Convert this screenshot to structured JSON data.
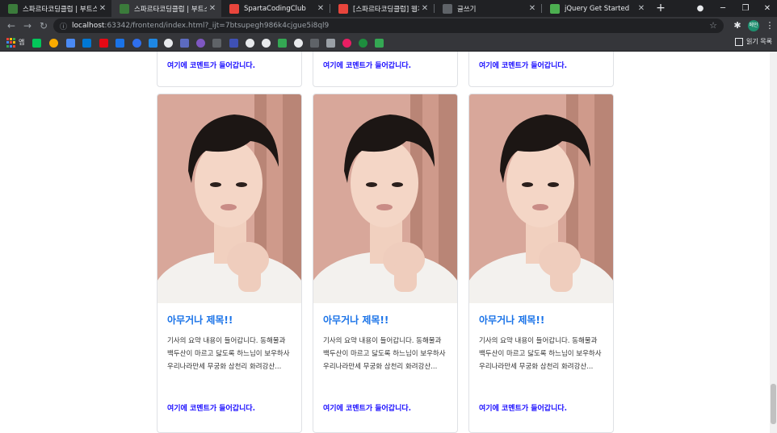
{
  "browser": {
    "tabs": [
      {
        "title": "스파르타코딩클럽 | 부트스",
        "favicon_color": "#3b7b3b",
        "active": false
      },
      {
        "title": "스파르타코딩클럽 | 부트스",
        "favicon_color": "#3b7b3b",
        "active": true
      },
      {
        "title": "SpartaCodingClub",
        "favicon_color": "#e8453c",
        "active": false
      },
      {
        "title": "[스파르타코딩클럽] 웹개발",
        "favicon_color": "#e8453c",
        "active": false
      },
      {
        "title": "글쓰기",
        "favicon_color": "#9aa0a6",
        "active": false
      },
      {
        "title": "jQuery Get Started",
        "favicon_color": "#4caf50",
        "active": false
      }
    ],
    "tab_close_glyph": "✕",
    "new_tab_glyph": "+",
    "url_host": "localhost",
    "url_rest": ":63342/frontend/index.html?_ijt=7btsupegh986k4cjgue5i8ql9",
    "profile_label": "메인",
    "bookmarks_first_label": "앱",
    "reading_list_label": "읽기 목록"
  },
  "colors": {
    "title_blue": "#1a73e8",
    "comment_blue": "#1a0dff",
    "chrome_dark": "#202124"
  },
  "cards_top": [
    {
      "comment": "여기에 코멘트가 들어갑니다."
    },
    {
      "comment": "여기에 코멘트가 들어갑니다."
    },
    {
      "comment": "여기에 코멘트가 들어갑니다."
    }
  ],
  "cards": [
    {
      "title": "아무거나 제목!!",
      "text": "기사의 요약 내용이 들어갑니다. 동해물과 백두산이 마르고 닳도록 하느님이 보우하사 우리나라만세 무궁화 삼천리 화려강산...",
      "comment": "여기에 코멘트가 들어갑니다.",
      "image_icon": "portrait-photo"
    },
    {
      "title": "아무거나 제목!!",
      "text": "기사의 요약 내용이 들어갑니다. 동해물과 백두산이 마르고 닳도록 하느님이 보우하사 우리나라만세 무궁화 삼천리 화려강산...",
      "comment": "여기에 코멘트가 들어갑니다.",
      "image_icon": "portrait-photo"
    },
    {
      "title": "아무거나 제목!!",
      "text": "기사의 요약 내용이 들어갑니다. 동해물과 백두산이 마르고 닳도록 하느님이 보우하사 우리나라만세 무궁화 삼천리 화려강산...",
      "comment": "여기에 코멘트가 들어갑니다.",
      "image_icon": "portrait-photo"
    }
  ]
}
